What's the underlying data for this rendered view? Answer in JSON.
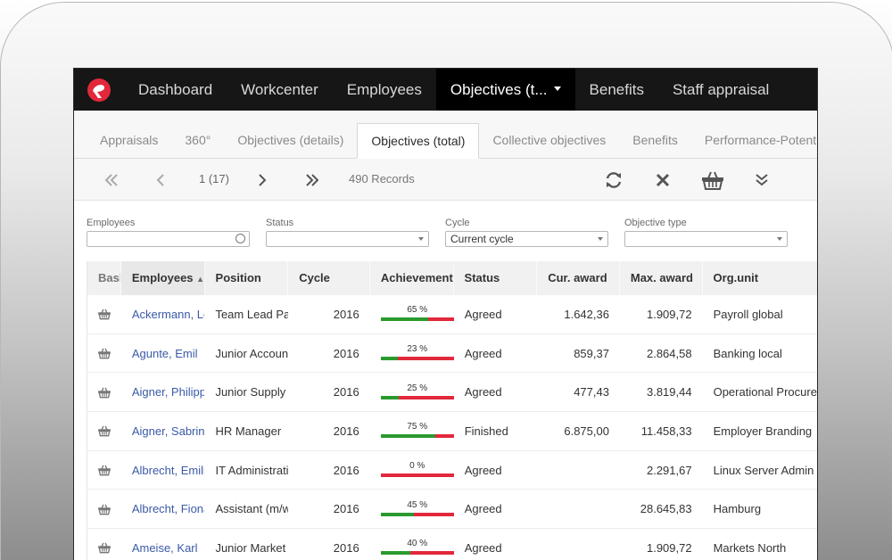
{
  "nav": {
    "items": [
      {
        "label": "Dashboard",
        "active": false
      },
      {
        "label": "Workcenter",
        "active": false
      },
      {
        "label": "Employees",
        "active": false
      },
      {
        "label": "Objectives (t...",
        "active": true
      },
      {
        "label": "Benefits",
        "active": false
      },
      {
        "label": "Staff appraisal",
        "active": false
      }
    ],
    "brand_color": "#e2283b"
  },
  "subtabs": [
    {
      "label": "Appraisals",
      "active": false
    },
    {
      "label": "360°",
      "active": false
    },
    {
      "label": "Objectives (details)",
      "active": false
    },
    {
      "label": "Objectives (total)",
      "active": true
    },
    {
      "label": "Collective objectives",
      "active": false
    },
    {
      "label": "Benefits",
      "active": false
    },
    {
      "label": "Performance-Potential-M",
      "active": false
    }
  ],
  "toolbar": {
    "page": "1 (17)",
    "records": "490 Records"
  },
  "filters": [
    {
      "label": "Employees",
      "value": "",
      "kind": "search"
    },
    {
      "label": "Status",
      "value": "",
      "kind": "select"
    },
    {
      "label": "Cycle",
      "value": "Current cycle",
      "kind": "select"
    },
    {
      "label": "Objective type",
      "value": "",
      "kind": "select"
    }
  ],
  "table": {
    "columns": [
      "Bask",
      "Employees",
      "Position",
      "Cycle",
      "Achievement g",
      "Status",
      "Cur. award",
      "Max. award",
      "Org.unit"
    ],
    "sort_indicator": "▲",
    "rows": [
      {
        "employee": "Ackermann, Le",
        "position": "Team Lead Pay",
        "cycle": "2016",
        "achievement": 65,
        "achievement_label": "65 %",
        "status": "Agreed",
        "cur_award": "1.642,36",
        "max_award": "1.909,72",
        "org_unit": "Payroll global"
      },
      {
        "employee": "Agunte, Emil",
        "position": "Junior Account",
        "cycle": "2016",
        "achievement": 23,
        "achievement_label": "23 %",
        "status": "Agreed",
        "cur_award": "859,37",
        "max_award": "2.864,58",
        "org_unit": "Banking local"
      },
      {
        "employee": "Aigner, Philipp",
        "position": "Junior Supply N",
        "cycle": "2016",
        "achievement": 25,
        "achievement_label": "25 %",
        "status": "Agreed",
        "cur_award": "477,43",
        "max_award": "3.819,44",
        "org_unit": "Operational Procure"
      },
      {
        "employee": "Aigner, Sabrina",
        "position": "HR Manager",
        "cycle": "2016",
        "achievement": 75,
        "achievement_label": "75 %",
        "status": "Finished",
        "cur_award": "6.875,00",
        "max_award": "11.458,33",
        "org_unit": "Employer Branding"
      },
      {
        "employee": "Albrecht, Emili",
        "position": "IT Administrati",
        "cycle": "2016",
        "achievement": 0,
        "achievement_label": "0 %",
        "status": "Agreed",
        "cur_award": "",
        "max_award": "2.291,67",
        "org_unit": "Linux Server Admin"
      },
      {
        "employee": "Albrecht, Fiona",
        "position": "Assistant (m/w",
        "cycle": "2016",
        "achievement": 45,
        "achievement_label": "45 %",
        "status": "Agreed",
        "cur_award": "",
        "max_award": "28.645,83",
        "org_unit": "Hamburg"
      },
      {
        "employee": "Ameise, Karl",
        "position": "Junior Market I",
        "cycle": "2016",
        "achievement": 40,
        "achievement_label": "40 %",
        "status": "Agreed",
        "cur_award": "",
        "max_award": "1.909,72",
        "org_unit": "Markets North"
      }
    ]
  }
}
